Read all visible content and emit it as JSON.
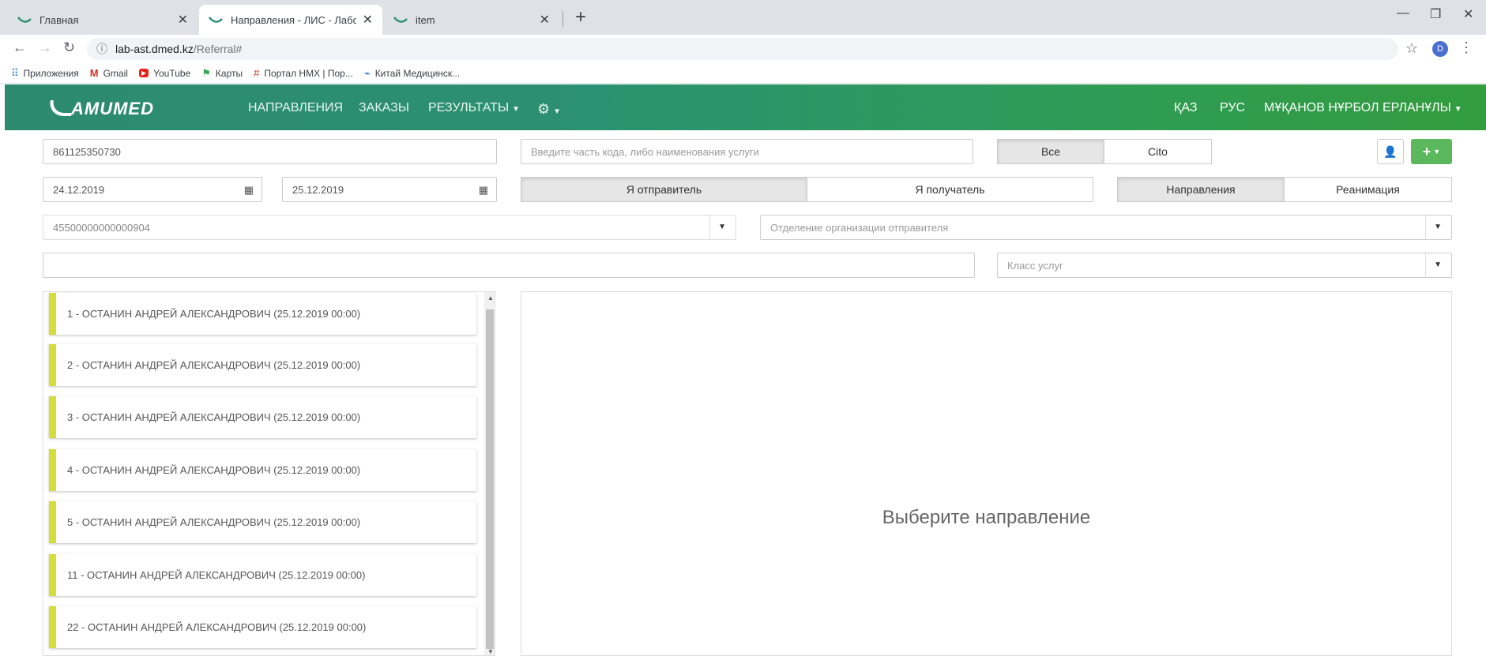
{
  "browser": {
    "tabs": [
      {
        "title": "Главная",
        "active": false
      },
      {
        "title": "Направления - ЛИС - Лаборато",
        "active": true
      },
      {
        "title": "item",
        "active": false
      }
    ],
    "url_host": "lab-ast.dmed.kz",
    "url_path": "/Referral#",
    "profile_initial": "D",
    "bookmarks": [
      {
        "label": "Приложения",
        "icon": "apps-grid-icon"
      },
      {
        "label": "Gmail",
        "icon": "gmail-icon"
      },
      {
        "label": "YouTube",
        "icon": "youtube-icon"
      },
      {
        "label": "Карты",
        "icon": "maps-icon"
      },
      {
        "label": "Портал НМХ | Пор...",
        "icon": "portal-icon"
      },
      {
        "label": "Китай Медицинск...",
        "icon": "china-med-icon"
      }
    ]
  },
  "navbar": {
    "logo": "AMUMED",
    "links": [
      "НАПРАВЛЕНИЯ",
      "ЗАКАЗЫ",
      "РЕЗУЛЬТАТЫ"
    ],
    "lang_kz": "ҚАЗ",
    "lang_ru": "РУС",
    "user": "МҰҚАНОВ НҰРБОЛ ЕРЛАНҰЛЫ"
  },
  "filters": {
    "search_value": "861125350730",
    "service_placeholder": "Введите часть кода, либо наименования услуги",
    "priority_all": "Все",
    "priority_cito": "Cito",
    "date_from": "24.12.2019",
    "date_to": "25.12.2019",
    "role_sender": "Я отправитель",
    "role_receiver": "Я получатель",
    "type_referrals": "Направления",
    "type_reanimation": "Реанимация",
    "org_value": "45500000000000904",
    "department_placeholder": "Отделение организации отправителя",
    "extra_value": "",
    "service_class_placeholder": "Класс услуг"
  },
  "referrals": [
    "1 - ОСТАНИН АНДРЕЙ АЛЕКСАНДРОВИЧ (25.12.2019 00:00)",
    "2 - ОСТАНИН АНДРЕЙ АЛЕКСАНДРОВИЧ (25.12.2019 00:00)",
    "3 - ОСТАНИН АНДРЕЙ АЛЕКСАНДРОВИЧ (25.12.2019 00:00)",
    "4 - ОСТАНИН АНДРЕЙ АЛЕКСАНДРОВИЧ (25.12.2019 00:00)",
    "5 - ОСТАНИН АНДРЕЙ АЛЕКСАНДРОВИЧ (25.12.2019 00:00)",
    "11 - ОСТАНИН АНДРЕЙ АЛЕКСАНДРОВИЧ (25.12.2019 00:00)",
    "22 - ОСТАНИН АНДРЕЙ АЛЕКСАНДРОВИЧ (25.12.2019 00:00)"
  ],
  "detail": {
    "empty_message": "Выберите направление"
  },
  "colors": {
    "brand_green": "#2c9170",
    "card_accent": "#d4dd3a",
    "add_button": "#5cb85c"
  }
}
